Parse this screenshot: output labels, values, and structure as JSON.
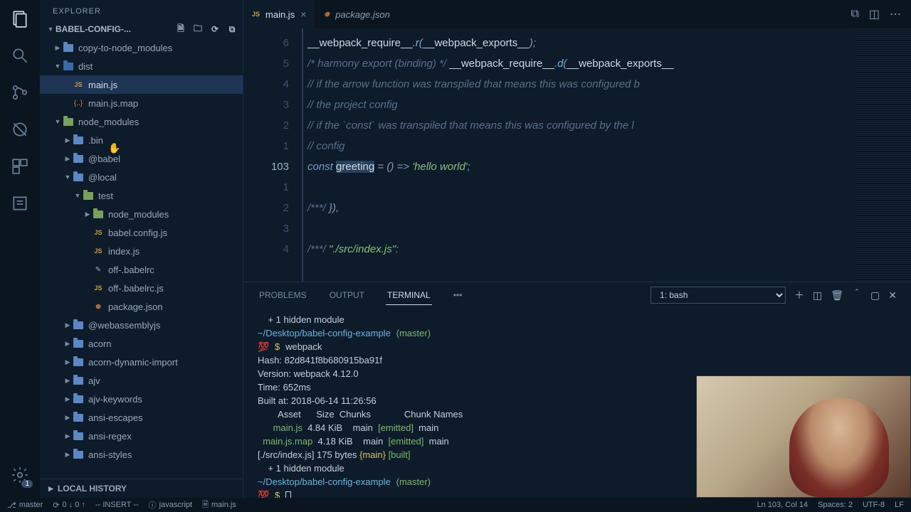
{
  "sidebar": {
    "title": "EXPLORER",
    "project": "BABEL-CONFIG-...",
    "footer": "LOCAL HISTORY",
    "tree": [
      {
        "indent": 0,
        "chev": "▶",
        "kind": "folder",
        "label": "copy-to-node_modules"
      },
      {
        "indent": 0,
        "chev": "▼",
        "kind": "folder-open",
        "label": "dist"
      },
      {
        "indent": 1,
        "chev": "",
        "kind": "js",
        "label": "main.js",
        "selected": true
      },
      {
        "indent": 1,
        "chev": "",
        "kind": "map",
        "label": "main.js.map"
      },
      {
        "indent": 0,
        "chev": "▼",
        "kind": "folder-green",
        "label": "node_modules"
      },
      {
        "indent": 1,
        "chev": "▶",
        "kind": "folder",
        "label": ".bin"
      },
      {
        "indent": 1,
        "chev": "▶",
        "kind": "folder",
        "label": "@babel"
      },
      {
        "indent": 1,
        "chev": "▼",
        "kind": "folder",
        "label": "@local"
      },
      {
        "indent": 2,
        "chev": "▼",
        "kind": "folder-green",
        "label": "test"
      },
      {
        "indent": 3,
        "chev": "▶",
        "kind": "folder-green",
        "label": "node_modules"
      },
      {
        "indent": 3,
        "chev": "",
        "kind": "js",
        "label": "babel.config.js"
      },
      {
        "indent": 3,
        "chev": "",
        "kind": "js",
        "label": "index.js"
      },
      {
        "indent": 3,
        "chev": "",
        "kind": "cfg",
        "label": "off-.babelrc"
      },
      {
        "indent": 3,
        "chev": "",
        "kind": "js",
        "label": "off-.babelrc.js"
      },
      {
        "indent": 3,
        "chev": "",
        "kind": "json",
        "label": "package.json"
      },
      {
        "indent": 1,
        "chev": "▶",
        "kind": "folder",
        "label": "@webassemblyjs"
      },
      {
        "indent": 1,
        "chev": "▶",
        "kind": "folder",
        "label": "acorn"
      },
      {
        "indent": 1,
        "chev": "▶",
        "kind": "folder",
        "label": "acorn-dynamic-import"
      },
      {
        "indent": 1,
        "chev": "▶",
        "kind": "folder",
        "label": "ajv"
      },
      {
        "indent": 1,
        "chev": "▶",
        "kind": "folder",
        "label": "ajv-keywords"
      },
      {
        "indent": 1,
        "chev": "▶",
        "kind": "folder",
        "label": "ansi-escapes"
      },
      {
        "indent": 1,
        "chev": "▶",
        "kind": "folder",
        "label": "ansi-regex"
      },
      {
        "indent": 1,
        "chev": "▶",
        "kind": "folder",
        "label": "ansi-styles"
      }
    ]
  },
  "tabs": [
    {
      "label": "main.js",
      "icon": "js",
      "active": true,
      "close": true
    },
    {
      "label": "package.json",
      "icon": "json",
      "active": false,
      "close": false
    }
  ],
  "editor": {
    "gutter": [
      "6",
      "5",
      "4",
      "3",
      "2",
      "1",
      "103",
      "1",
      "2",
      "3",
      "4"
    ],
    "current_line": 6
  },
  "panel": {
    "tabs": [
      "PROBLEMS",
      "OUTPUT",
      "TERMINAL"
    ],
    "active": 2,
    "select": "1: bash",
    "terminal_prompt_path": "~/Desktop/babel-config-example",
    "terminal_branch": "(master)",
    "terminal_cmd": "webpack",
    "hash": "Hash: 82d841f8b680915ba91f",
    "version": "Version: webpack 4.12.0",
    "time": "Time: 652ms",
    "built": "Built at: 2018-06-14 11:26:56",
    "header": "        Asset      Size  Chunks             Chunk Names",
    "row1_a": "      main.js",
    "row1_b": "  4.84 KiB    main  ",
    "row1_c": "[emitted]",
    "row1_d": "  main",
    "row2_a": "  main.js.map",
    "row2_b": "  4.18 KiB    main  ",
    "row2_c": "[emitted]",
    "row2_d": "  main",
    "entry_a": "[./src/index.js] 175 bytes ",
    "entry_b": "{main}",
    "entry_c": " [built]",
    "hidden": "    + 1 hidden module"
  },
  "status": {
    "branch": "master",
    "sync": "0 ↓ 0 ↑",
    "mode": "-- INSERT --",
    "lang_icon": "ⓘ",
    "lang": "javascript",
    "file": "main.js",
    "pos": "Ln 103, Col 14",
    "spaces": "Spaces: 2",
    "enc": "UTF-8",
    "eol": "LF"
  },
  "activity_badge": "1"
}
